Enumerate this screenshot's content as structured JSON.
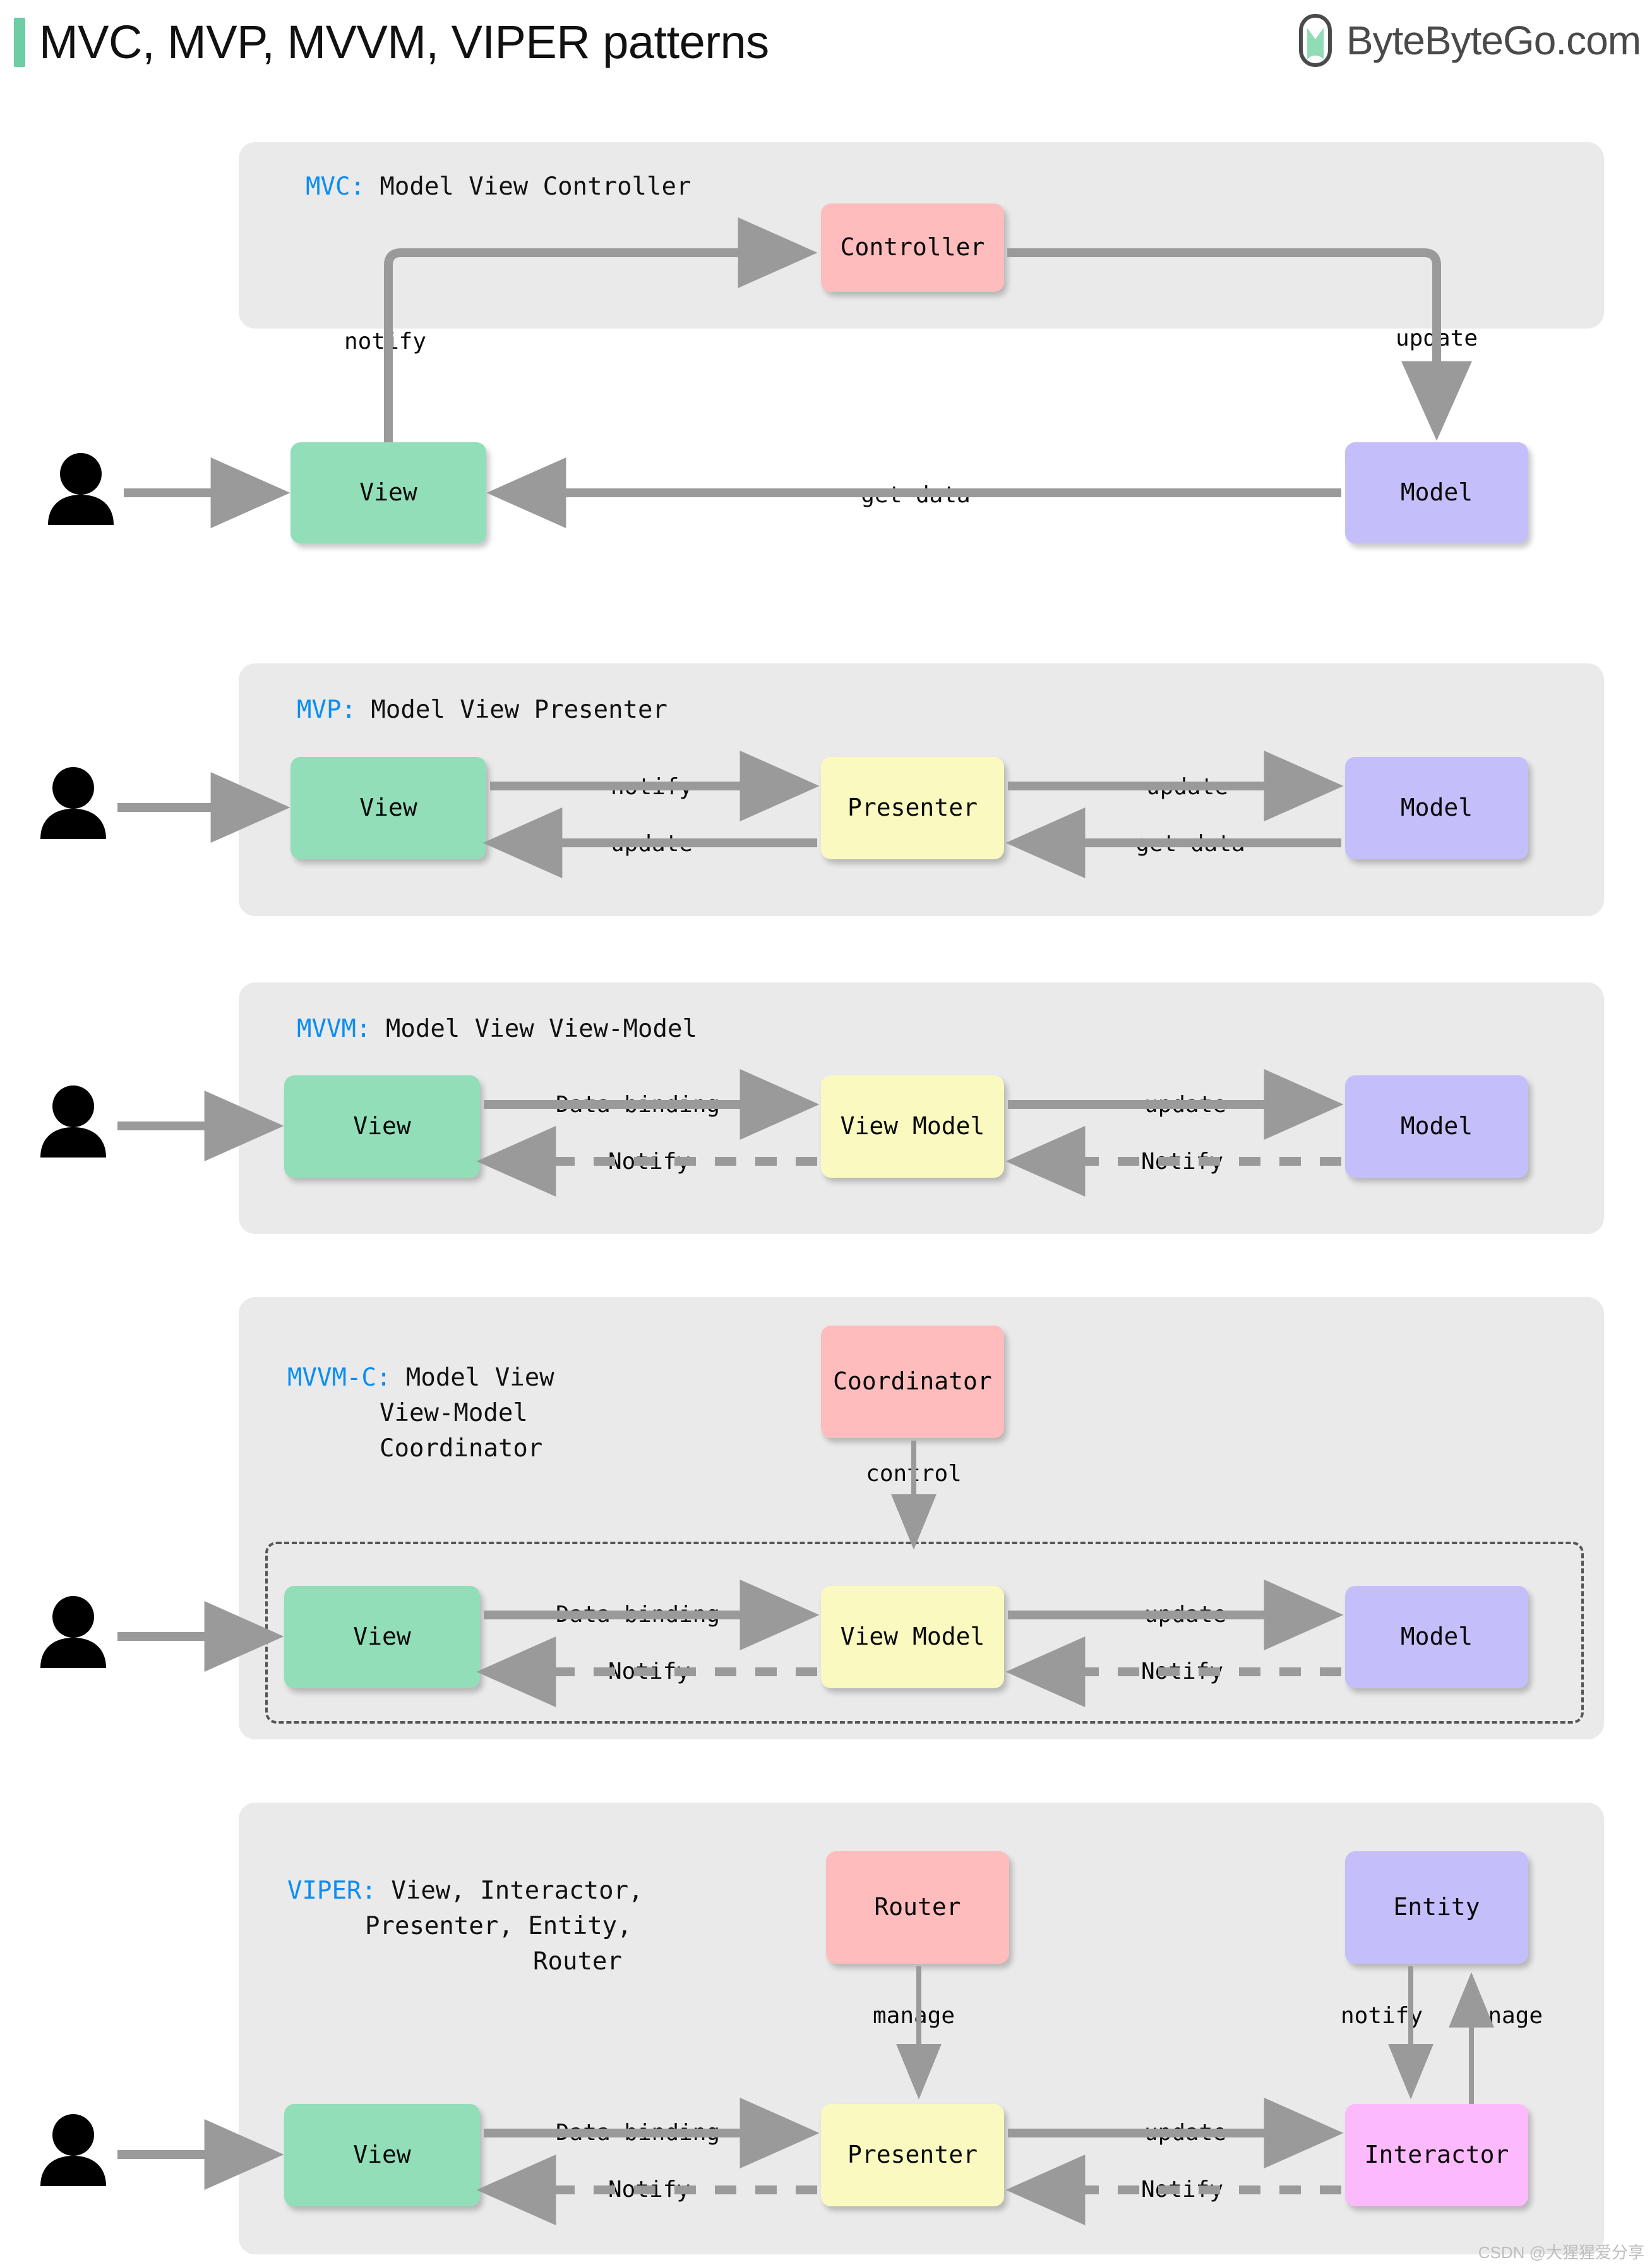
{
  "header": {
    "title": "MVC, MVP, MVVM, VIPER patterns",
    "accent_color": "#6ECDA4",
    "brand_name": "ByteByteGo.com",
    "brand_icon": "bytebytego-logo-icon"
  },
  "palette": {
    "panel_bg": "#EAEAEA",
    "view": "#91DEB8",
    "model": "#C4BFFB",
    "view_model": "#FAFAC0",
    "controller": "#FFBCBC",
    "interactor": "#FCB9FC",
    "arrow": "#9A9A9A",
    "caption_key": "#0B8EF2"
  },
  "sections": [
    {
      "id": "mvc",
      "key": "MVC:",
      "caption": " Model View Controller",
      "nodes": [
        {
          "name": "view",
          "label": "View"
        },
        {
          "name": "controller",
          "label": "Controller"
        },
        {
          "name": "model",
          "label": "Model"
        }
      ],
      "edges": [
        {
          "from": "view",
          "to": "controller",
          "label": "notify",
          "style": "solid"
        },
        {
          "from": "controller",
          "to": "model",
          "label": "update",
          "style": "solid"
        },
        {
          "from": "model",
          "to": "view",
          "label": "get data",
          "style": "solid"
        },
        {
          "from": "user",
          "to": "view",
          "label": "",
          "style": "solid"
        }
      ]
    },
    {
      "id": "mvp",
      "key": "MVP:",
      "caption": " Model View Presenter",
      "nodes": [
        {
          "name": "view",
          "label": "View"
        },
        {
          "name": "presenter",
          "label": "Presenter"
        },
        {
          "name": "model",
          "label": "Model"
        }
      ],
      "edges": [
        {
          "from": "view",
          "to": "presenter",
          "label": "notify",
          "style": "solid"
        },
        {
          "from": "presenter",
          "to": "model",
          "label": "update",
          "style": "solid"
        },
        {
          "from": "presenter",
          "to": "view",
          "label": "update",
          "style": "solid"
        },
        {
          "from": "model",
          "to": "presenter",
          "label": "get data",
          "style": "solid"
        }
      ]
    },
    {
      "id": "mvvm",
      "key": "MVVM:",
      "caption": " Model View View-Model",
      "nodes": [
        {
          "name": "view",
          "label": "View"
        },
        {
          "name": "view-model",
          "label": "View Model"
        },
        {
          "name": "model",
          "label": "Model"
        }
      ],
      "edges": [
        {
          "from": "view",
          "to": "view-model",
          "label": "Data binding",
          "style": "solid"
        },
        {
          "from": "view-model",
          "to": "model",
          "label": "update",
          "style": "solid"
        },
        {
          "from": "view-model",
          "to": "view",
          "label": "Notify",
          "style": "dashed"
        },
        {
          "from": "model",
          "to": "view-model",
          "label": "Notify",
          "style": "dashed"
        }
      ]
    },
    {
      "id": "mvvm-c",
      "key": "MVVM-C:",
      "caption": " Model View\n  View-Model\n  Coordinator",
      "nodes": [
        {
          "name": "coordinator",
          "label": "Coordinator"
        },
        {
          "name": "view",
          "label": "View"
        },
        {
          "name": "view-model",
          "label": "View Model"
        },
        {
          "name": "model",
          "label": "Model"
        }
      ],
      "edges": [
        {
          "from": "coordinator",
          "to": "group",
          "label": "control",
          "style": "solid"
        },
        {
          "from": "view",
          "to": "view-model",
          "label": "Data binding",
          "style": "solid"
        },
        {
          "from": "view-model",
          "to": "model",
          "label": "update",
          "style": "solid"
        },
        {
          "from": "view-model",
          "to": "view",
          "label": "Notify",
          "style": "dashed"
        },
        {
          "from": "model",
          "to": "view-model",
          "label": "Notify",
          "style": "dashed"
        }
      ]
    },
    {
      "id": "viper",
      "key": "VIPER:",
      "caption": " View, Interactor,\n Presenter, Entity,\n        Router",
      "nodes": [
        {
          "name": "router",
          "label": "Router"
        },
        {
          "name": "entity",
          "label": "Entity"
        },
        {
          "name": "view",
          "label": "View"
        },
        {
          "name": "presenter",
          "label": "Presenter"
        },
        {
          "name": "interactor",
          "label": "Interactor"
        }
      ],
      "edges": [
        {
          "from": "router",
          "to": "presenter",
          "label": "manage",
          "style": "solid"
        },
        {
          "from": "entity",
          "to": "interactor",
          "label": "notify",
          "style": "solid"
        },
        {
          "from": "interactor",
          "to": "entity",
          "label": "manage",
          "style": "solid"
        },
        {
          "from": "view",
          "to": "presenter",
          "label": "Data binding",
          "style": "solid"
        },
        {
          "from": "presenter",
          "to": "interactor",
          "label": "update",
          "style": "solid"
        },
        {
          "from": "presenter",
          "to": "view",
          "label": "Notify",
          "style": "dashed"
        },
        {
          "from": "interactor",
          "to": "presenter",
          "label": "Notify",
          "style": "dashed"
        }
      ]
    }
  ],
  "labels": {
    "mvc_title_key": "MVC:",
    "mvc_title_rest": " Model View Controller",
    "mvc_notify": "notify",
    "mvc_update": "update",
    "mvc_getdata": "get data",
    "mvc_view": "View",
    "mvc_controller": "Controller",
    "mvc_model": "Model",
    "mvp_title_key": "MVP:",
    "mvp_title_rest": " Model View Presenter",
    "mvp_notify": "notify",
    "mvp_update_right": "update",
    "mvp_update_left": "update",
    "mvp_getdata": "get data",
    "mvp_view": "View",
    "mvp_presenter": "Presenter",
    "mvp_model": "Model",
    "mvvm_title_key": "MVVM:",
    "mvvm_title_rest": " Model View View-Model",
    "mvvm_databinding": "Data binding",
    "mvvm_update": "update",
    "mvvm_notify_left": "Notify",
    "mvvm_notify_right": "Notify",
    "mvvm_view": "View",
    "mvvm_viewmodel": "View Model",
    "mvvm_model": "Model",
    "mvvmc_title_key": "MVVM-C:",
    "mvvmc_title_l1": " Model View",
    "mvvmc_title_l2": "View-Model",
    "mvvmc_title_l3": "Coordinator",
    "mvvmc_coordinator": "Coordinator",
    "mvvmc_control": "control",
    "mvvmc_databinding": "Data binding",
    "mvvmc_update": "update",
    "mvvmc_notify_left": "Notify",
    "mvvmc_notify_right": "Notify",
    "mvvmc_view": "View",
    "mvvmc_viewmodel": "View Model",
    "mvvmc_model": "Model",
    "viper_title_key": "VIPER:",
    "viper_title_l1": " View, Interactor,",
    "viper_title_l2": "Presenter, Entity,",
    "viper_title_l3": "Router",
    "viper_router": "Router",
    "viper_entity": "Entity",
    "viper_manage_router": "manage",
    "viper_notify_entity": "notify",
    "viper_manage_entity": "manage",
    "viper_databinding": "Data binding",
    "viper_update": "update",
    "viper_notify_left": "Notify",
    "viper_notify_right": "Notify",
    "viper_view": "View",
    "viper_presenter": "Presenter",
    "viper_interactor": "Interactor"
  },
  "watermark": "CSDN @大猩猩爱分享"
}
